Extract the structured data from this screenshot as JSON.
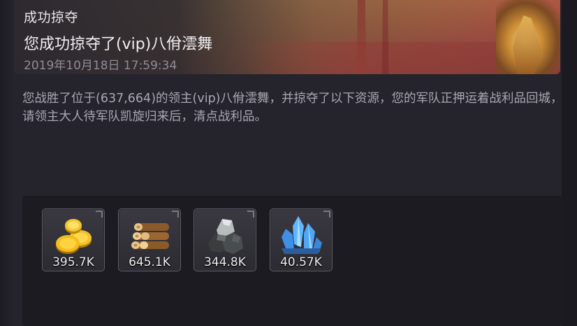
{
  "mail": {
    "title": "成功掠夺",
    "subject": "您成功掠夺了(vip)八佾澐舞",
    "datetime": "2019年10月18日 17:59:34",
    "body": "您战胜了位于(637,664)的领主(vip)八佾澐舞，并掠夺了以下资源，您的军队正押运着战利品回城，请领主大人待军队凯旋归来后，清点战利品。"
  },
  "rewards": [
    {
      "icon": "gold-coins-icon",
      "amount": "395.7K"
    },
    {
      "icon": "wood-logs-icon",
      "amount": "645.1K"
    },
    {
      "icon": "stone-ore-icon",
      "amount": "344.8K"
    },
    {
      "icon": "blue-crystal-icon",
      "amount": "40.57K"
    }
  ],
  "colors": {
    "background": "#25242d",
    "panel": "#1c1b22",
    "text_primary": "#f1eff2",
    "text_secondary": "#a9a7b1",
    "text_muted": "#8e8c95"
  }
}
